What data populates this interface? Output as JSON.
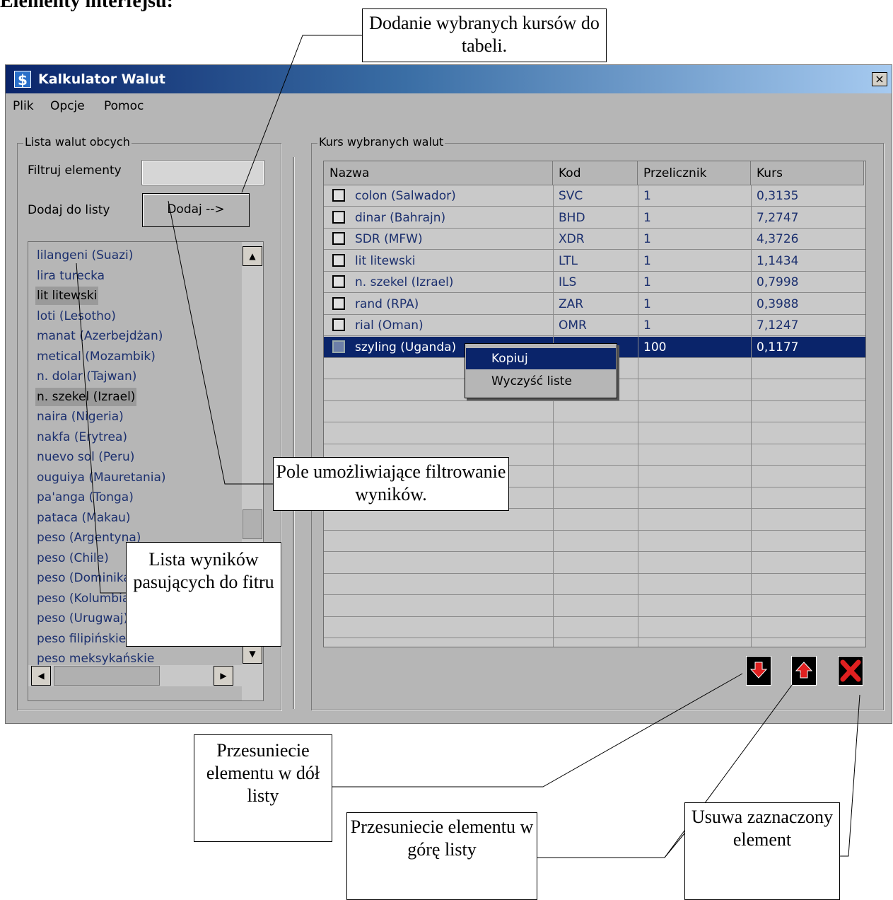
{
  "heading": "Elementy interfejsu:",
  "window": {
    "title": "Kalkulator Walut",
    "app_icon": "$",
    "close_label": "×",
    "menu": [
      "Plik",
      "Opcje",
      "Pomoc"
    ]
  },
  "left_panel": {
    "group_title": "Lista walut obcych",
    "filter_label": "Filtruj elementy",
    "filter_value": "",
    "add_label": "Dodaj do listy",
    "add_button": "Dodaj -->",
    "list_items": [
      "lilangeni (Suazi)",
      "lira turecka",
      "lit litewski",
      "loti (Lesotho)",
      "manat (Azerbejdżan)",
      "metical (Mozambik)",
      "n. dolar (Tajwan)",
      "n. szekel (Izrael)",
      "naira (Nigeria)",
      "nakfa (Erytrea)",
      "nuevo sol (Peru)",
      "ouguiya (Mauretania)",
      "pa'anga (Tonga)",
      "pataca (Makau)",
      "peso (Argentyna)",
      "peso (Chile)",
      "peso (Dominikana)",
      "peso (Kolumbia)",
      "peso (Urugwaj)",
      "peso filipińskie",
      "peso meksykańskie"
    ],
    "selected_items": [
      "lit litewski",
      "n. szekel (Izrael)"
    ]
  },
  "right_panel": {
    "group_title": "Kurs wybranych walut",
    "columns": [
      "Nazwa",
      "Kod",
      "Przelicznik",
      "Kurs"
    ],
    "rows": [
      {
        "name": "colon (Salwador)",
        "code": "SVC",
        "ratio": "1",
        "rate": "0,3135"
      },
      {
        "name": "dinar (Bahrajn)",
        "code": "BHD",
        "ratio": "1",
        "rate": "7,2747"
      },
      {
        "name": "SDR (MFW)",
        "code": "XDR",
        "ratio": "1",
        "rate": "4,3726"
      },
      {
        "name": "lit litewski",
        "code": "LTL",
        "ratio": "1",
        "rate": "1,1434"
      },
      {
        "name": "n. szekel (Izrael)",
        "code": "ILS",
        "ratio": "1",
        "rate": "0,7998"
      },
      {
        "name": "rand (RPA)",
        "code": "ZAR",
        "ratio": "1",
        "rate": "0,3988"
      },
      {
        "name": "rial (Oman)",
        "code": "OMR",
        "ratio": "1",
        "rate": "7,1247"
      },
      {
        "name": "szyling (Uganda)",
        "code": "",
        "ratio": "100",
        "rate": "0,1177"
      }
    ],
    "selected_row": 7,
    "context_menu": [
      "Kopiuj",
      "Wyczyść liste"
    ],
    "buttons": {
      "down": "arrow-down-icon",
      "up": "arrow-up-icon",
      "remove": "delete-x-icon"
    }
  },
  "callouts": {
    "add": "Dodanie wybranych kursów do tabeli.",
    "filter": "Pole umożliwiające filtrowanie wyników.",
    "list": "Lista wyników pasujących do fitru",
    "down": "Przesuniecie elementu w dół listy",
    "up": "Przesuniecie elementu w górę listy",
    "remove": "Usuwa zaznaczony element"
  },
  "colors": {
    "selection": "#0a246a",
    "accent_red": "#e02020"
  }
}
